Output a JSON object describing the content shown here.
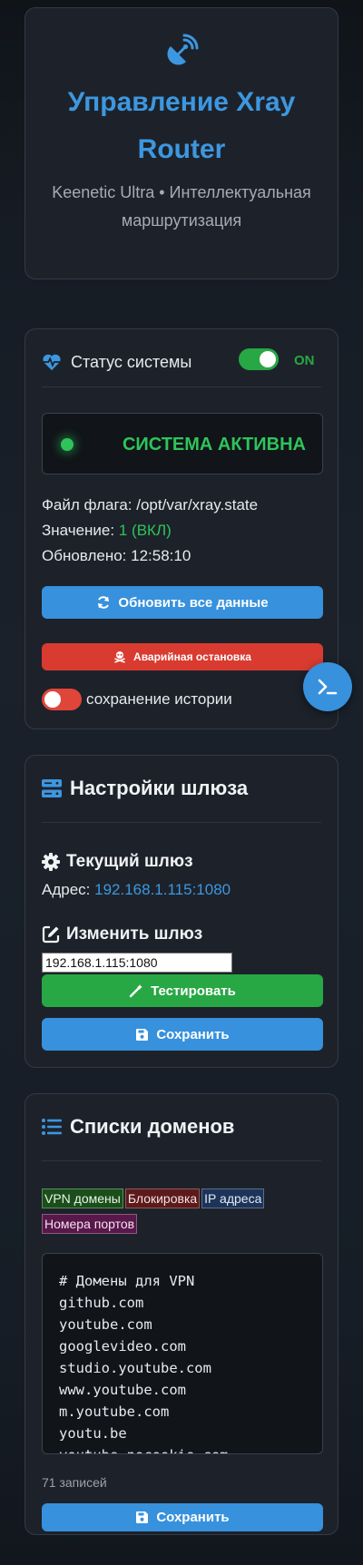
{
  "header": {
    "title": "Управление Xray Router",
    "subtitle": "Keenetic Ultra • Интеллектуальная маршрутизация",
    "logo_icon": "satellite-dish-icon",
    "accent": "#3d97e0"
  },
  "status": {
    "title": "Статус системы",
    "toggle_state": "ON",
    "panel_label": "СИСТЕМА АКТИВНА",
    "flag_file_label": "Файл флага:",
    "flag_file_value": "/opt/var/xray.state",
    "value_label": "Значение:",
    "value_value": "1 (ВКЛ)",
    "updated_label": "Обновлено:",
    "updated_value": "12:58:10",
    "refresh_button": "Обновить все данные",
    "emergency_button": "Аварийная остановка",
    "history_label": "сохранение истории",
    "colors": {
      "success": "#28a745",
      "danger": "#d93b30",
      "primary": "#3791dc"
    }
  },
  "gateway": {
    "title": "Настройки шлюза",
    "current_title": "Текущий шлюз",
    "address_label": "Адрес:",
    "address_value": "192.168.1.115:1080",
    "change_title": "Изменить шлюз",
    "input_value": "192.168.1.115:1080",
    "test_button": "Тестировать",
    "save_button": "Сохранить"
  },
  "domains": {
    "title": "Списки доменов",
    "tabs": [
      "VPN домены",
      "Блокировка",
      "IP адреса",
      "Номера портов"
    ],
    "content": "# Домены для VPN\ngithub.com\nyoutube.com\ngooglevideo.com\nstudio.youtube.com\nwww.youtube.com\nm.youtube.com\nyoutu.be\nyoutube-nocookie.com",
    "count_text": "71 записей",
    "save_button": "Сохранить"
  }
}
